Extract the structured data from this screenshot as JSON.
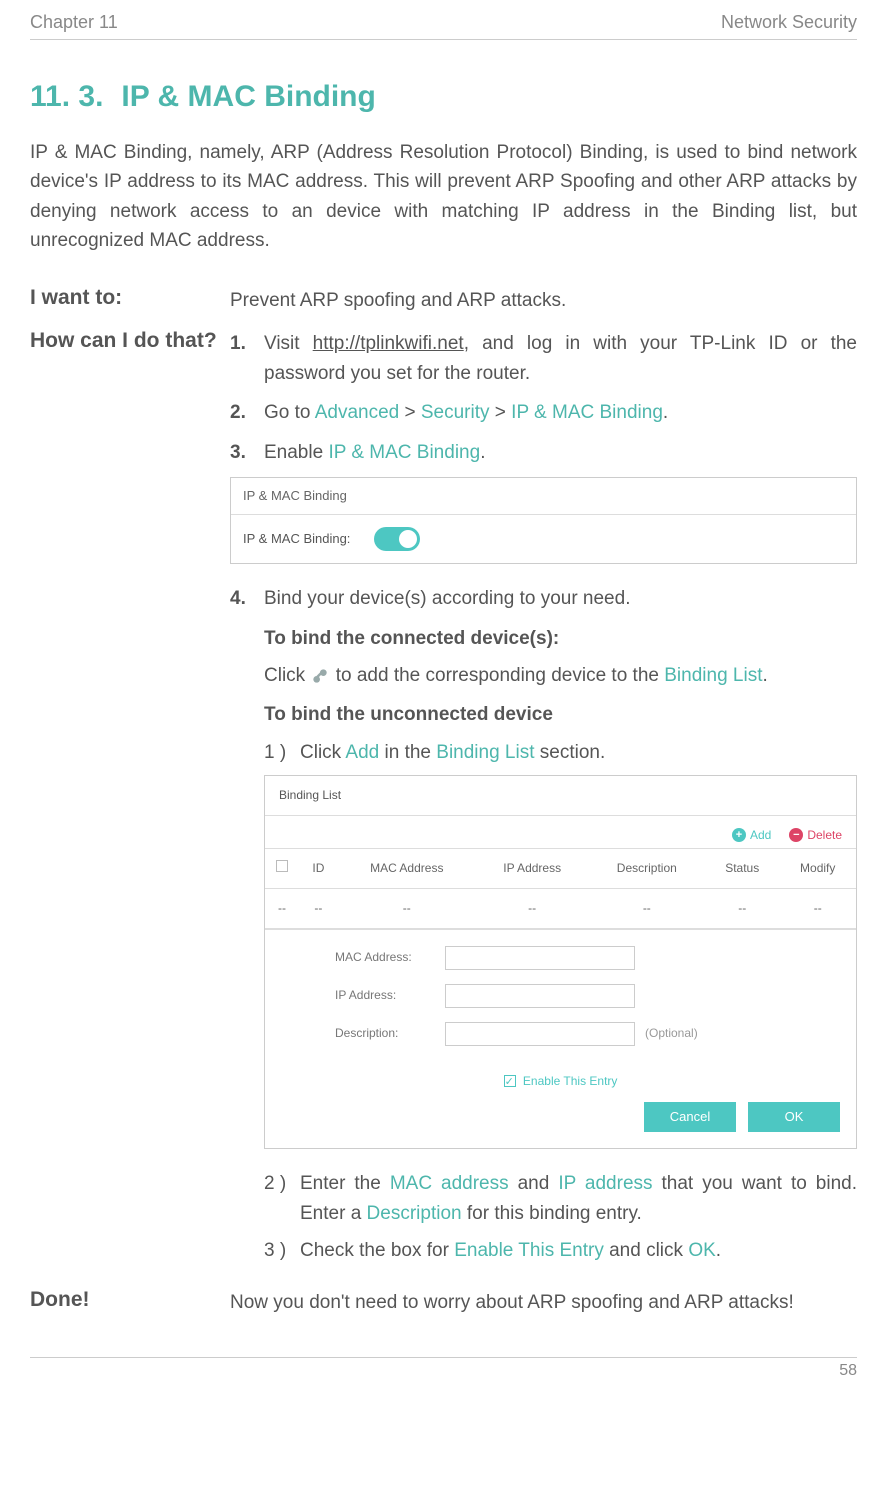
{
  "header": {
    "left": "Chapter 11",
    "right": "Network Security"
  },
  "title": {
    "num": "11. 3.",
    "text": "IP & MAC Binding"
  },
  "intro": "IP & MAC Binding, namely, ARP (Address Resolution Protocol) Binding, is used to bind network device's IP address to its MAC address. This will prevent ARP Spoofing and other ARP attacks by denying network access to an device with matching IP address in the Binding list, but unrecognized MAC address.",
  "labels": {
    "want": "I want to:",
    "how": "How can I do that?",
    "done": "Done!"
  },
  "want_text": "Prevent ARP spoofing and ARP attacks.",
  "steps": {
    "s1": {
      "num": "1.",
      "a": "Visit ",
      "link": "http://tplinkwifi.net",
      "b": ", and log in with your TP-Link ID or the password you set for the router."
    },
    "s2": {
      "num": "2.",
      "a": "Go to ",
      "p1": "Advanced",
      "sep": " > ",
      "p2": "Security",
      "p3": "IP & MAC Binding",
      "end": "."
    },
    "s3": {
      "num": "3.",
      "a": "Enable ",
      "t": "IP & MAC Binding",
      "end": "."
    },
    "s4": {
      "num": "4.",
      "a": "Bind your device(s) according to your need."
    }
  },
  "panel1": {
    "title": "IP & MAC Binding",
    "label": "IP & MAC Binding:"
  },
  "sub": {
    "h1": "To bind the connected device(s):",
    "click_a": "Click ",
    "click_b": " to add the corresponding device to the ",
    "binding_list": "Binding List",
    "click_end": ".",
    "h2": "To bind the unconnected device",
    "s1n": "1 )",
    "s1a": "Click ",
    "s1add": "Add",
    "s1b": " in the ",
    "s1c": " section."
  },
  "binding_panel": {
    "title": "Binding List",
    "add": "Add",
    "delete": "Delete",
    "cols": [
      "",
      "ID",
      "MAC Address",
      "IP Address",
      "Description",
      "Status",
      "Modify"
    ],
    "empty_row": [
      "--",
      "--",
      "--",
      "--",
      "--",
      "--",
      "--"
    ],
    "form": {
      "mac": "MAC Address:",
      "ip": "IP Address:",
      "desc": "Description:",
      "optional": "(Optional)",
      "enable": "Enable This Entry"
    },
    "buttons": {
      "cancel": "Cancel",
      "ok": "OK"
    }
  },
  "after": {
    "s2n": "2 )",
    "s2a": "Enter the ",
    "s2mac": "MAC address",
    "s2and": " and ",
    "s2ip": "IP address",
    "s2b": " that you want to bind. Enter a ",
    "s2desc": "Description",
    "s2c": " for this binding entry.",
    "s3n": "3 )",
    "s3a": "Check the box for ",
    "s3en": "Enable This Entry",
    "s3b": " and click ",
    "s3ok": "OK",
    "s3c": "."
  },
  "done_text": "Now you don't need to worry about ARP spoofing and ARP attacks!",
  "page_num": "58"
}
